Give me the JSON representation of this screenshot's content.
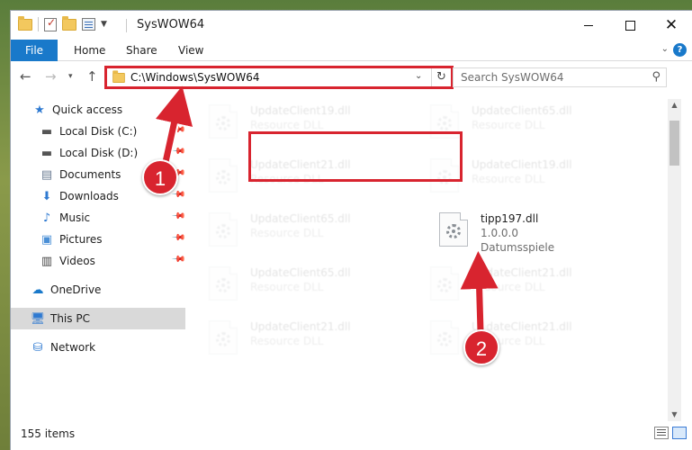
{
  "window": {
    "title": "SysWOW64",
    "controls": {
      "minimize": "",
      "maximize": "",
      "close": "✕"
    }
  },
  "ribbon": {
    "tabs": [
      "File",
      "Home",
      "Share",
      "View"
    ]
  },
  "address": {
    "path": "C:\\Windows\\SysWOW64",
    "search_placeholder": "Search SysWOW64"
  },
  "sidebar": {
    "items": [
      {
        "label": "Quick access",
        "icon": "star-icon"
      },
      {
        "label": "Local Disk (C:)",
        "icon": "drive-icon",
        "pinned": true
      },
      {
        "label": "Local Disk (D:)",
        "icon": "drive-icon",
        "pinned": true
      },
      {
        "label": "Documents",
        "icon": "documents-icon",
        "pinned": true
      },
      {
        "label": "Downloads",
        "icon": "download-icon",
        "pinned": true
      },
      {
        "label": "Music",
        "icon": "music-icon",
        "pinned": true
      },
      {
        "label": "Pictures",
        "icon": "pictures-icon",
        "pinned": true
      },
      {
        "label": "Videos",
        "icon": "videos-icon",
        "pinned": true
      },
      {
        "label": "OneDrive",
        "icon": "cloud-icon"
      },
      {
        "label": "This PC",
        "icon": "computer-icon",
        "selected": true
      },
      {
        "label": "Network",
        "icon": "network-icon"
      }
    ]
  },
  "files": [
    {
      "name": "UpdateClient19.dll",
      "type": "Resource DLL",
      "faded": true
    },
    {
      "name": "UpdateClient65.dll",
      "type": "Resource DLL",
      "faded": true
    },
    {
      "name": "UpdateClient21.dll",
      "type": "Resource DLL",
      "faded": true
    },
    {
      "name": "UpdateClient19.dll",
      "type": "Resource DLL",
      "faded": true
    },
    {
      "name": "UpdateClient65.dll",
      "type": "Resource DLL",
      "faded": true
    },
    {
      "name": "tipp197.dll",
      "version": "1.0.0.0",
      "type": "Datumsspiele",
      "faded": false
    },
    {
      "name": "UpdateClient65.dll",
      "type": "Resource DLL",
      "faded": true
    },
    {
      "name": "UpdateClient21.dll",
      "type": "Resource DLL",
      "faded": true
    },
    {
      "name": "UpdateClient21.dll",
      "type": "Resource DLL",
      "faded": true
    },
    {
      "name": "UpdateClient21.dll",
      "type": "Resource DLL",
      "faded": true
    }
  ],
  "status": {
    "item_count": "155 items"
  },
  "annotations": {
    "step1": "1",
    "step2": "2",
    "accent_color": "#d8242f"
  }
}
